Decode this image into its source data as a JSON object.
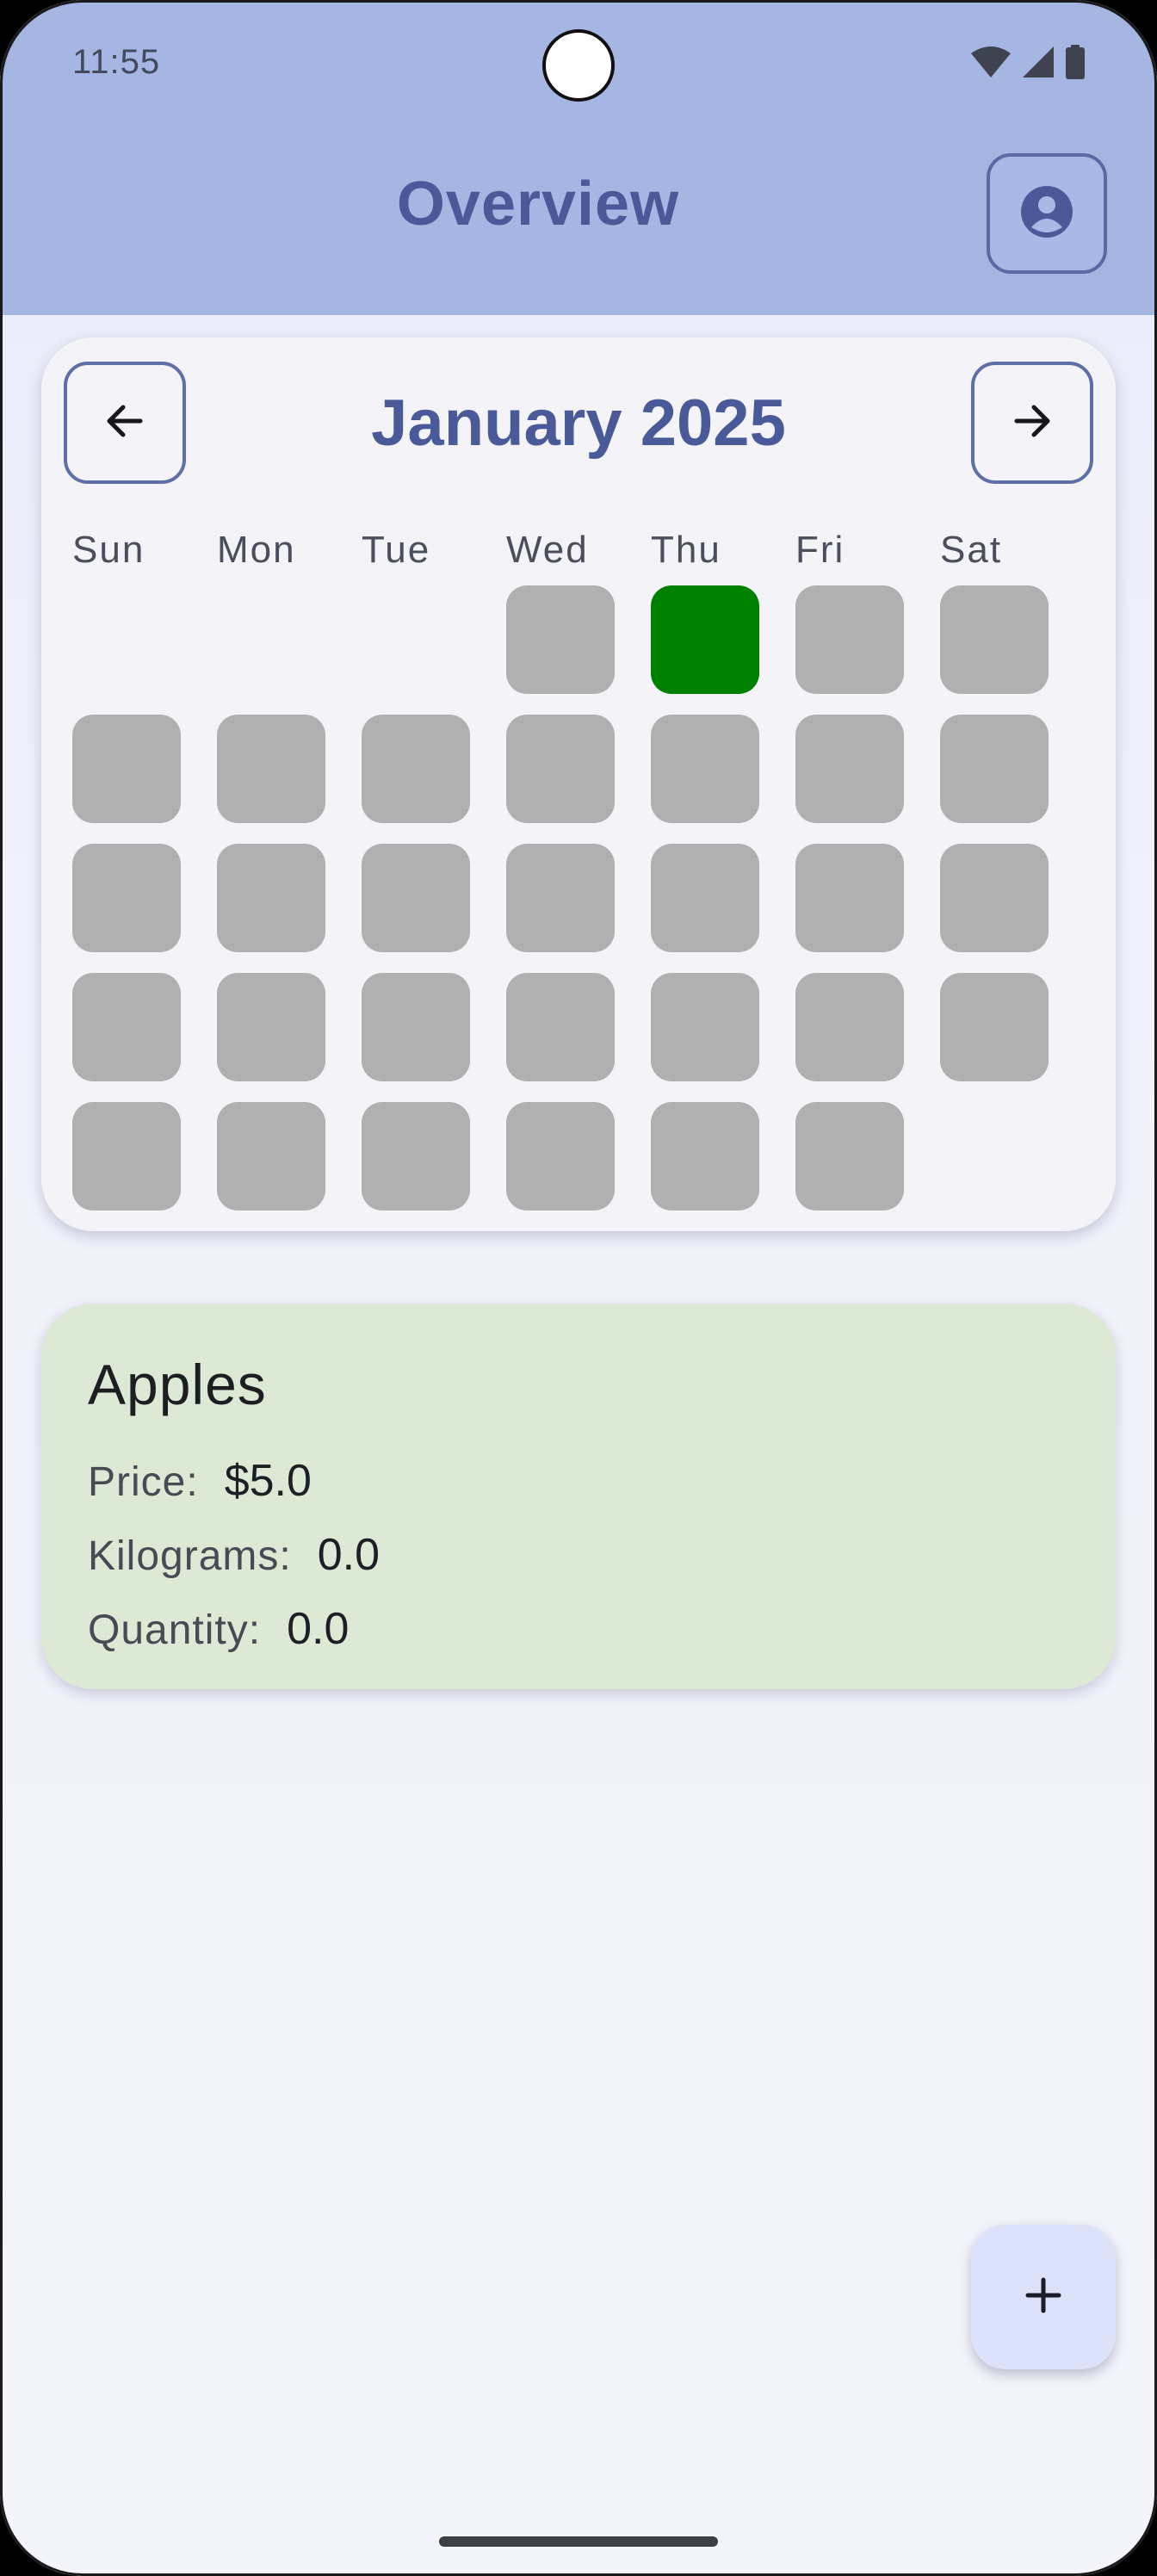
{
  "status_bar": {
    "time": "11:55",
    "icons": [
      "wifi-icon",
      "signal-icon",
      "battery-icon"
    ]
  },
  "app_bar": {
    "title": "Overview",
    "profile_icon": "account-circle-icon"
  },
  "calendar": {
    "month_title": "January 2025",
    "prev_icon": "arrow-left-icon",
    "next_icon": "arrow-right-icon",
    "weekdays": [
      "Sun",
      "Mon",
      "Tue",
      "Wed",
      "Thu",
      "Fri",
      "Sat"
    ],
    "first_weekday_index": 3,
    "days_in_month": 31,
    "selected_day": 2,
    "colors": {
      "day": "#b0b0b0",
      "selected": "#008000"
    }
  },
  "item": {
    "name": "Apples",
    "price_label": "Price:",
    "price_value": "$5.0",
    "kilograms_label": "Kilograms:",
    "kilograms_value": "0.0",
    "quantity_label": "Quantity:",
    "quantity_value": "0.0",
    "background_color": "#dcead5"
  },
  "fab": {
    "icon": "plus-icon"
  },
  "theme": {
    "app_bar_color": "#a6b6e2",
    "accent": "#4a5a99"
  }
}
